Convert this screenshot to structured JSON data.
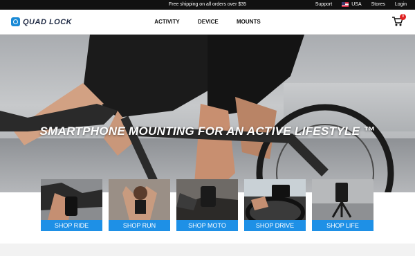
{
  "topbar": {
    "promo": "Free shipping on all orders over $35",
    "support": "Support",
    "country": "USA",
    "stores": "Stores",
    "login": "Login"
  },
  "header": {
    "logo_text": "QUAD LOCK",
    "nav": [
      "ACTIVITY",
      "DEVICE",
      "MOUNTS"
    ],
    "cart_count": "0"
  },
  "hero": {
    "headline": "SMARTPHONE MOUNTING FOR AN ACTIVE LIFESTYLE ™"
  },
  "tiles": [
    {
      "label": "SHOP RIDE"
    },
    {
      "label": "SHOP RUN"
    },
    {
      "label": "SHOP MOTO"
    },
    {
      "label": "SHOP DRIVE"
    },
    {
      "label": "SHOP LIFE"
    }
  ],
  "colors": {
    "accent": "#1e90e6",
    "topbar": "#111111",
    "cart_badge": "#e02020"
  },
  "icons": [
    "flag-usa-icon",
    "cart-icon",
    "quad-lock-logo-icon"
  ]
}
